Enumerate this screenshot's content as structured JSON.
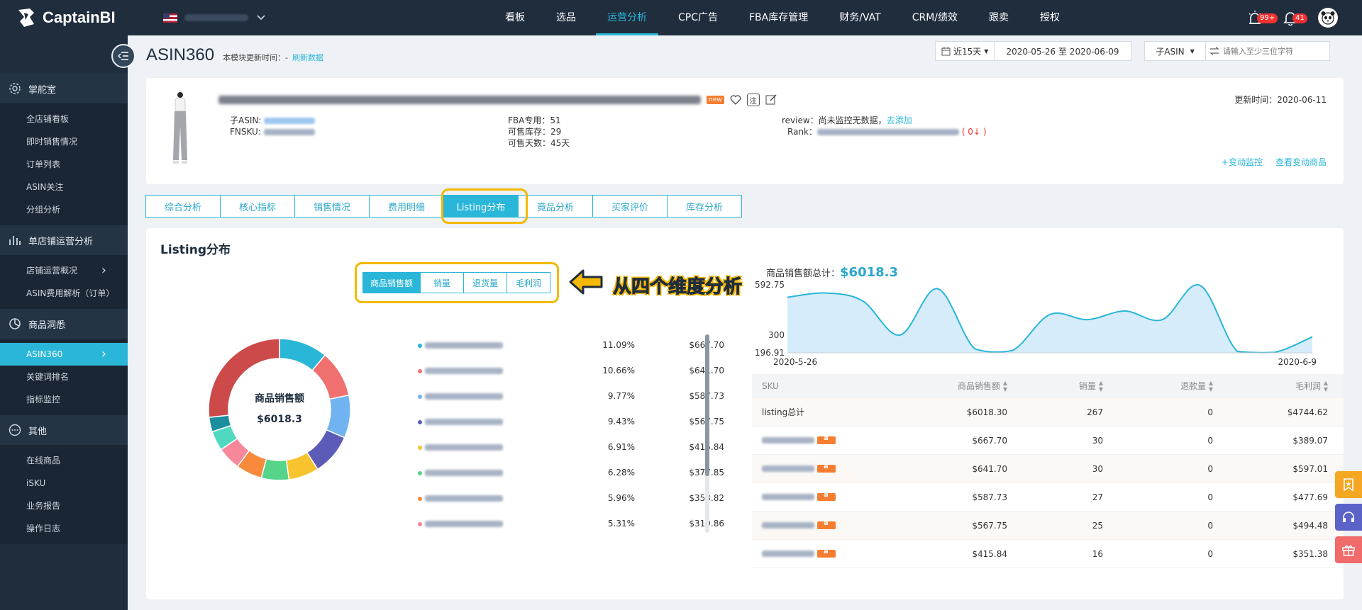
{
  "topbar": {
    "logo_text": "CaptainBI",
    "nav": [
      "看板",
      "选品",
      "运营分析",
      "CPC广告",
      "FBA库存管理",
      "财务/VAT",
      "CRM/绩效",
      "跟卖",
      "授权"
    ],
    "active_nav": 2,
    "alerts_badge": "99+",
    "notifications_badge": "41"
  },
  "sidebar": {
    "sections": [
      {
        "label": "掌舵室",
        "icon": "gear-icon",
        "items": [
          "全店铺看板",
          "即时销售情况",
          "订单列表",
          "ASIN关注",
          "分组分析"
        ]
      },
      {
        "label": "单店铺运营分析",
        "icon": "bar-chart-icon",
        "items": [
          "店铺运营概况",
          "ASIN费用解析（订单）"
        ]
      },
      {
        "label": "商品洞悉",
        "icon": "pie-chart-icon",
        "items": [
          "ASIN360",
          "关键词排名",
          "指标监控"
        ]
      },
      {
        "label": "其他",
        "icon": "more-icon",
        "items": [
          "在线商品",
          "iSKU",
          "业务报告",
          "操作日志"
        ]
      }
    ]
  },
  "header": {
    "title": "ASIN360",
    "update_label": "本模块更新时间：-",
    "refresh": "刷新数据",
    "range_label": "近15天",
    "date_range": "2020-05-26 至 2020-06-09",
    "asin_type": "子ASIN",
    "search_placeholder": "请输入至少三位字符"
  },
  "product": {
    "new_badge": "new",
    "note_icon_text": "注",
    "child_asin_label": "子ASIN:",
    "fnsku_label": "FNSKU:",
    "fba_label": "FBA专用：51",
    "stock_label": "可售库存：29",
    "days_label": "可售天数：45天",
    "review_label": "review：尚未监控无数据，",
    "review_link": "去添加",
    "rank_label": "Rank：",
    "rank_change": "( 0↓ )",
    "update_time": "更新时间：2020-06-11",
    "link_monitor": "+变动监控",
    "link_view": "查看变动商品"
  },
  "tabs": [
    "综合分析",
    "核心指标",
    "销售情况",
    "费用明细",
    "Listing分布",
    "竟品分析",
    "买家评价",
    "库存分析"
  ],
  "active_tab": 4,
  "listing": {
    "title": "Listing分布",
    "dims": [
      "商品销售额",
      "销量",
      "退货量",
      "毛利润"
    ],
    "active_dim": 0,
    "annotation": "从四个维度分析",
    "donut_label": "商品销售额",
    "donut_total": "$6018.3",
    "legend": [
      {
        "pct": "11.09%",
        "amt": "$667.70",
        "color": "#2ab6d6"
      },
      {
        "pct": "10.66%",
        "amt": "$641.70",
        "color": "#f07070"
      },
      {
        "pct": "9.77%",
        "amt": "$587.73",
        "color": "#6fb3f0"
      },
      {
        "pct": "9.43%",
        "amt": "$567.75",
        "color": "#5c5cb8"
      },
      {
        "pct": "6.91%",
        "amt": "$415.84",
        "color": "#f7c430"
      },
      {
        "pct": "6.28%",
        "amt": "$377.85",
        "color": "#55d48a"
      },
      {
        "pct": "5.96%",
        "amt": "$358.82",
        "color": "#f88a3c"
      },
      {
        "pct": "5.31%",
        "amt": "$319.86",
        "color": "#f7889b"
      }
    ],
    "donut_rest": [
      {
        "pct": 4.5,
        "color": "#4ed9c0"
      },
      {
        "pct": 3.3,
        "color": "#1b8e9e"
      },
      {
        "pct": 26.78,
        "color": "#cc4a4a"
      }
    ],
    "sales_total_label": "商品销售额总计：",
    "sales_total": "$6018.3",
    "table": {
      "headers": [
        "SKU",
        "商品销售额",
        "销量",
        "退款量",
        "毛利润"
      ],
      "rows": [
        {
          "sku": "listing总计",
          "sales": "$6018.30",
          "qty": "267",
          "refund": "0",
          "profit": "$4744.62",
          "total": true
        },
        {
          "sku": "",
          "sales": "$667.70",
          "qty": "30",
          "refund": "0",
          "profit": "$389.07"
        },
        {
          "sku": "",
          "sales": "$641.70",
          "qty": "30",
          "refund": "0",
          "profit": "$597.01"
        },
        {
          "sku": "",
          "sales": "$587.73",
          "qty": "27",
          "refund": "0",
          "profit": "$477.69"
        },
        {
          "sku": "",
          "sales": "$567.75",
          "qty": "25",
          "refund": "0",
          "profit": "$494.48"
        },
        {
          "sku": "",
          "sales": "$415.84",
          "qty": "16",
          "refund": "0",
          "profit": "$351.38"
        }
      ]
    }
  },
  "chart_data": {
    "type": "area",
    "x_start_label": "2020-5-26",
    "x_end_label": "2020-6-9",
    "y_ticks": [
      "592.75",
      "300",
      "196.91"
    ],
    "ylim": [
      196.91,
      592.75
    ],
    "x": [
      "2020-5-26",
      "2020-5-27",
      "2020-5-28",
      "2020-5-29",
      "2020-5-30",
      "2020-5-31",
      "2020-6-1",
      "2020-6-2",
      "2020-6-3",
      "2020-6-4",
      "2020-6-5",
      "2020-6-6",
      "2020-6-7",
      "2020-6-8",
      "2020-6-9"
    ],
    "values": [
      520,
      545,
      500,
      300,
      570,
      220,
      210,
      420,
      390,
      440,
      390,
      590,
      205,
      200,
      290
    ],
    "color": "#29b6d8"
  }
}
